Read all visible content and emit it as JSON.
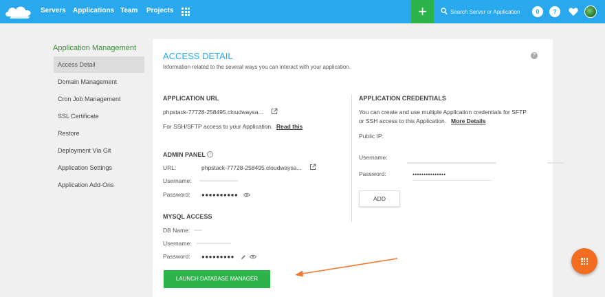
{
  "nav": {
    "links": [
      "Servers",
      "Applications",
      "Team",
      "Projects"
    ],
    "plus": "+",
    "search_placeholder": "Search Server or Application",
    "notification_count": "0",
    "help": "?"
  },
  "sidebar": {
    "title": "Application Management",
    "items": [
      {
        "label": "Access Detail",
        "active": true
      },
      {
        "label": "Domain Management"
      },
      {
        "label": "Cron Job Management"
      },
      {
        "label": "SSL Certificate"
      },
      {
        "label": "Restore"
      },
      {
        "label": "Deployment Via Git"
      },
      {
        "label": "Application Settings"
      },
      {
        "label": "Application Add-Ons"
      }
    ]
  },
  "main": {
    "title": "ACCESS DETAIL",
    "subtitle": "Information related to the several ways you can interact with your application.",
    "help": "?",
    "app_url": {
      "heading": "APPLICATION URL",
      "url": "phpstack-77728-258495.cloudwaysa...",
      "note": "For SSH/SFTP access to your Application.",
      "note_link": "Read this"
    },
    "admin_panel": {
      "heading": "ADMIN PANEL",
      "url_label": "URL:",
      "url_value": "phpstack-77728-258495.cloudwaysa...",
      "username_label": "Username:",
      "password_label": "Password:",
      "password_mask": "●●●●●●●●●●"
    },
    "mysql": {
      "heading": "MYSQL ACCESS",
      "db_label": "DB Name:",
      "username_label": "Username:",
      "password_label": "Password:",
      "password_mask": "●●●●●●●●●",
      "launch_label": "LAUNCH DATABASE MANAGER"
    },
    "credentials": {
      "heading": "APPLICATION CREDENTIALS",
      "desc_line1": "You can create and use multiple Application credentials for SFTP",
      "desc_line2": "or SSH access to this Application.",
      "more_link": "More Details",
      "public_ip_label": "Public IP:",
      "username_label": "Username:",
      "password_label": "Password:",
      "password_mask": "●●●●●●●●●●●●●●●",
      "add_label": "ADD"
    }
  },
  "colors": {
    "topbar": "#2aa8ee",
    "accent_green": "#2cb34a",
    "fab_orange": "#f26d21",
    "sidebar_title": "#3a8a3a"
  },
  "icons": {
    "logo": "cloud-logo-icon",
    "apps_grid": "grid-icon",
    "search": "search-icon",
    "favorites": "heart-icon",
    "external": "external-link-icon",
    "reveal": "eye-icon",
    "edit": "pencil-icon",
    "info": "info-icon",
    "fab": "grid-menu-icon"
  }
}
